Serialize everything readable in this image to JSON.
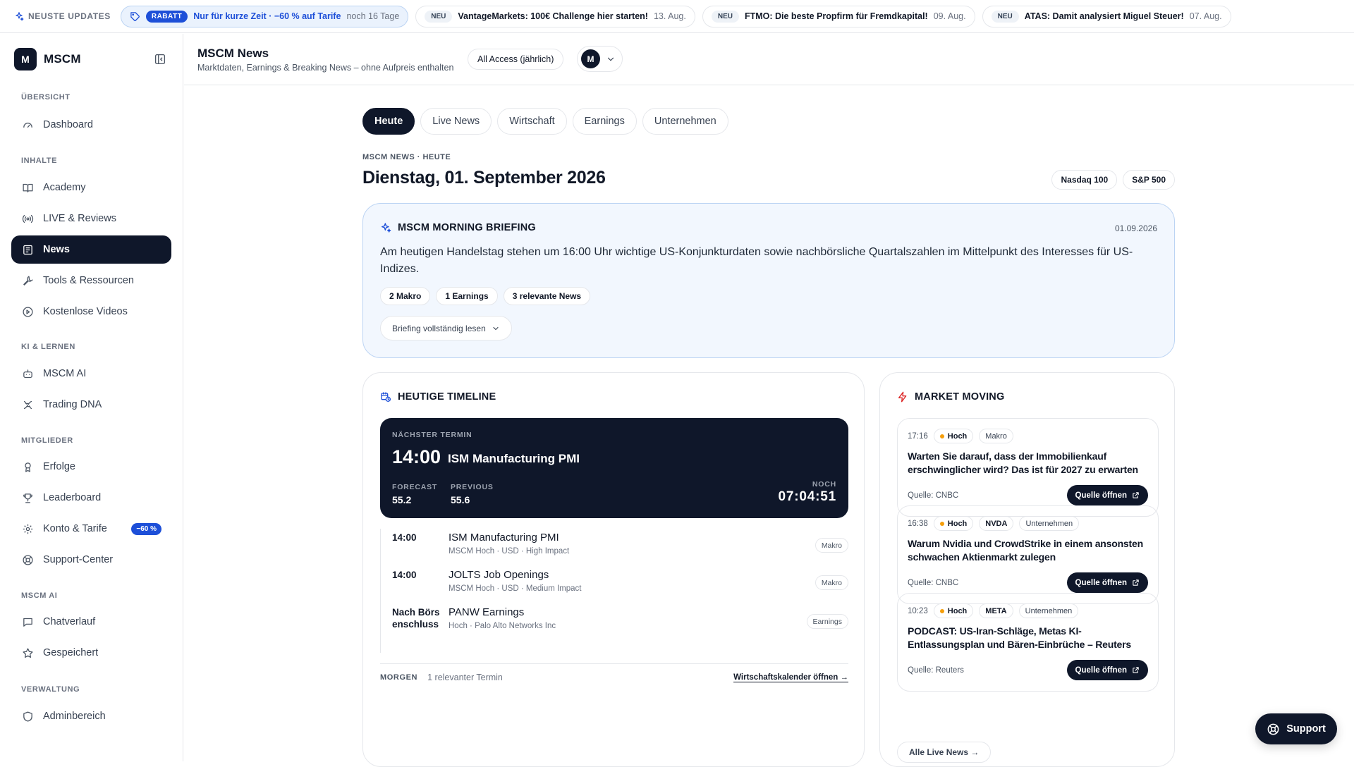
{
  "ticker": {
    "title": "NEUSTE UPDATES",
    "promo": {
      "tag": "RABATT",
      "text": "Nur für kurze Zeit · −60 % auf Tarife",
      "meta": "noch 16 Tage"
    },
    "items": [
      {
        "tag": "NEU",
        "title": "VantageMarkets: 100€ Challenge hier starten!",
        "date": "13. Aug."
      },
      {
        "tag": "NEU",
        "title": "FTMO: Die beste Propfirm für Fremdkapital!",
        "date": "09. Aug."
      },
      {
        "tag": "NEU",
        "title": "ATAS: Damit analysiert Miguel Steuer!",
        "date": "07. Aug."
      }
    ]
  },
  "sidebar": {
    "logo_letter": "M",
    "brand": "MSCM",
    "sections": {
      "overview": "ÜBERSICHT",
      "content": "INHALTE",
      "ai": "KI & LERNEN",
      "members": "MITGLIEDER",
      "mscm_ai": "MSCM AI",
      "admin": "VERWALTUNG"
    },
    "items": {
      "dashboard": "Dashboard",
      "academy": "Academy",
      "live": "LIVE & Reviews",
      "news": "News",
      "tools": "Tools & Ressourcen",
      "videos": "Kostenlose Videos",
      "mscm_ai": "MSCM AI",
      "dna": "Trading DNA",
      "erfolge": "Erfolge",
      "leaderboard": "Leaderboard",
      "konto": "Konto & Tarife",
      "konto_badge": "−60 %",
      "support": "Support-Center",
      "chat": "Chatverlauf",
      "saved": "Gespeichert",
      "admin": "Adminbereich"
    }
  },
  "header": {
    "title": "MSCM News",
    "subtitle": "Marktdaten, Earnings & Breaking News – ohne Aufpreis enthalten",
    "plan": "All Access (jährlich)",
    "avatar_letter": "M"
  },
  "tabs": [
    "Heute",
    "Live News",
    "Wirtschaft",
    "Earnings",
    "Unternehmen"
  ],
  "breadcrumb": "MSCM NEWS · HEUTE",
  "date_title": "Dienstag, 01. September 2026",
  "index_pills": [
    "Nasdaq 100",
    "S&P 500"
  ],
  "briefing": {
    "title": "MSCM MORNING BRIEFING",
    "date": "01.09.2026",
    "text": "Am heutigen Handelstag stehen um 16:00 Uhr wichtige US-Konjunkturdaten sowie nachbörsliche Quartalszahlen im Mittelpunkt des Interesses für US-Indizes.",
    "tags": [
      "2 Makro",
      "1 Earnings",
      "3 relevante News"
    ],
    "button": "Briefing vollständig lesen"
  },
  "timeline": {
    "title": "HEUTIGE TIMELINE",
    "next": {
      "label": "NÄCHSTER TERMIN",
      "time": "14:00",
      "name": "ISM Manufacturing PMI",
      "forecast_label": "FORECAST",
      "forecast": "55.2",
      "previous_label": "PREVIOUS",
      "previous": "55.6",
      "countdown_label": "NOCH",
      "countdown": "07:04:51"
    },
    "events": [
      {
        "time": "14:00",
        "title": "ISM Manufacturing PMI",
        "meta": "MSCM Hoch · USD · High Impact",
        "tag": "Makro"
      },
      {
        "time": "14:00",
        "title": "JOLTS Job Openings",
        "meta": "MSCM Hoch · USD · Medium Impact",
        "tag": "Makro"
      },
      {
        "time": "Nach Börsenschluss",
        "title": "PANW Earnings",
        "meta": "Hoch · Palo Alto Networks Inc",
        "tag": "Earnings"
      }
    ],
    "footer_label": "MORGEN",
    "footer_text": "1 relevanter Termin",
    "footer_link": "Wirtschaftskalender öffnen →"
  },
  "market": {
    "title": "MARKET MOVING",
    "items": [
      {
        "time": "17:16",
        "priority": "Hoch",
        "ticker": "",
        "category": "Makro",
        "title": "Warten Sie darauf, dass der Immobilienkauf erschwinglicher wird? Das ist für 2027 zu erwarten",
        "source": "Quelle: CNBC",
        "button": "Quelle öffnen"
      },
      {
        "time": "16:38",
        "priority": "Hoch",
        "ticker": "NVDA",
        "category": "Unternehmen",
        "title": "Warum Nvidia und CrowdStrike in einem ansonsten schwachen Aktienmarkt zulegen",
        "source": "Quelle: CNBC",
        "button": "Quelle öffnen"
      },
      {
        "time": "10:23",
        "priority": "Hoch",
        "ticker": "META",
        "category": "Unternehmen",
        "title": "PODCAST: US-Iran-Schläge, Metas KI-Entlassungsplan und Bären-Einbrüche – Reuters",
        "source": "Quelle: Reuters",
        "button": "Quelle öffnen"
      }
    ],
    "all_link": "Alle Live News →"
  },
  "support_button": "Support",
  "colors": {
    "dark": "#0f172a",
    "accent": "#1d4fd8",
    "brief_bg": "#f2f7fe",
    "priority_dot": "#f59e0b"
  }
}
